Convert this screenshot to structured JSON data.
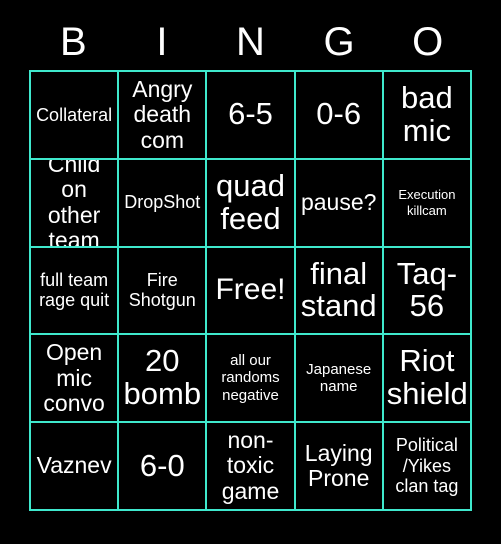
{
  "card": {
    "title": "BINGO",
    "border_color": "#3fe8cd",
    "background_color": "#000000",
    "text_color": "#ffffff"
  },
  "header": {
    "letters": [
      "B",
      "I",
      "N",
      "G",
      "O"
    ]
  },
  "grid": {
    "rows": 5,
    "columns": 5,
    "cells": [
      {
        "text": "Collateral",
        "size": "fs-md",
        "free": false
      },
      {
        "text": "Angry\ndeath\ncom",
        "size": "fs-lg",
        "free": false
      },
      {
        "text": "6-5",
        "size": "fs-xl",
        "free": false
      },
      {
        "text": "0-6",
        "size": "fs-xl",
        "free": false
      },
      {
        "text": "bad\nmic",
        "size": "fs-xl",
        "free": false
      },
      {
        "text": "Child on\nother\nteam",
        "size": "fs-lg",
        "free": false
      },
      {
        "text": "DropShot",
        "size": "fs-md",
        "free": false
      },
      {
        "text": "quad\nfeed",
        "size": "fs-xl",
        "free": false
      },
      {
        "text": "pause?",
        "size": "fs-lg",
        "free": false
      },
      {
        "text": "Execution\nkillcam",
        "size": "fs-xs",
        "free": false
      },
      {
        "text": "full team\nrage quit",
        "size": "fs-md",
        "free": false
      },
      {
        "text": "Fire\nShotgun",
        "size": "fs-md",
        "free": false
      },
      {
        "text": "Free!",
        "size": "fs-free",
        "free": true
      },
      {
        "text": "final\nstand",
        "size": "fs-xl",
        "free": false
      },
      {
        "text": "Taq-\n56",
        "size": "fs-xl",
        "free": false
      },
      {
        "text": "Open\nmic\nconvo",
        "size": "fs-lg",
        "free": false
      },
      {
        "text": "20\nbomb",
        "size": "fs-xl",
        "free": false
      },
      {
        "text": "all our\nrandoms\nnegative",
        "size": "fs-sm",
        "free": false
      },
      {
        "text": "Japanese\nname",
        "size": "fs-sm",
        "free": false
      },
      {
        "text": "Riot\nshield",
        "size": "fs-xl",
        "free": false
      },
      {
        "text": "Vaznev",
        "size": "fs-lg",
        "free": false
      },
      {
        "text": "6-0",
        "size": "fs-xl",
        "free": false
      },
      {
        "text": "non-\ntoxic\ngame",
        "size": "fs-lg",
        "free": false
      },
      {
        "text": "Laying\nProne",
        "size": "fs-lg",
        "free": false
      },
      {
        "text": "Political\n/Yikes\nclan tag",
        "size": "fs-md",
        "free": false
      }
    ]
  }
}
